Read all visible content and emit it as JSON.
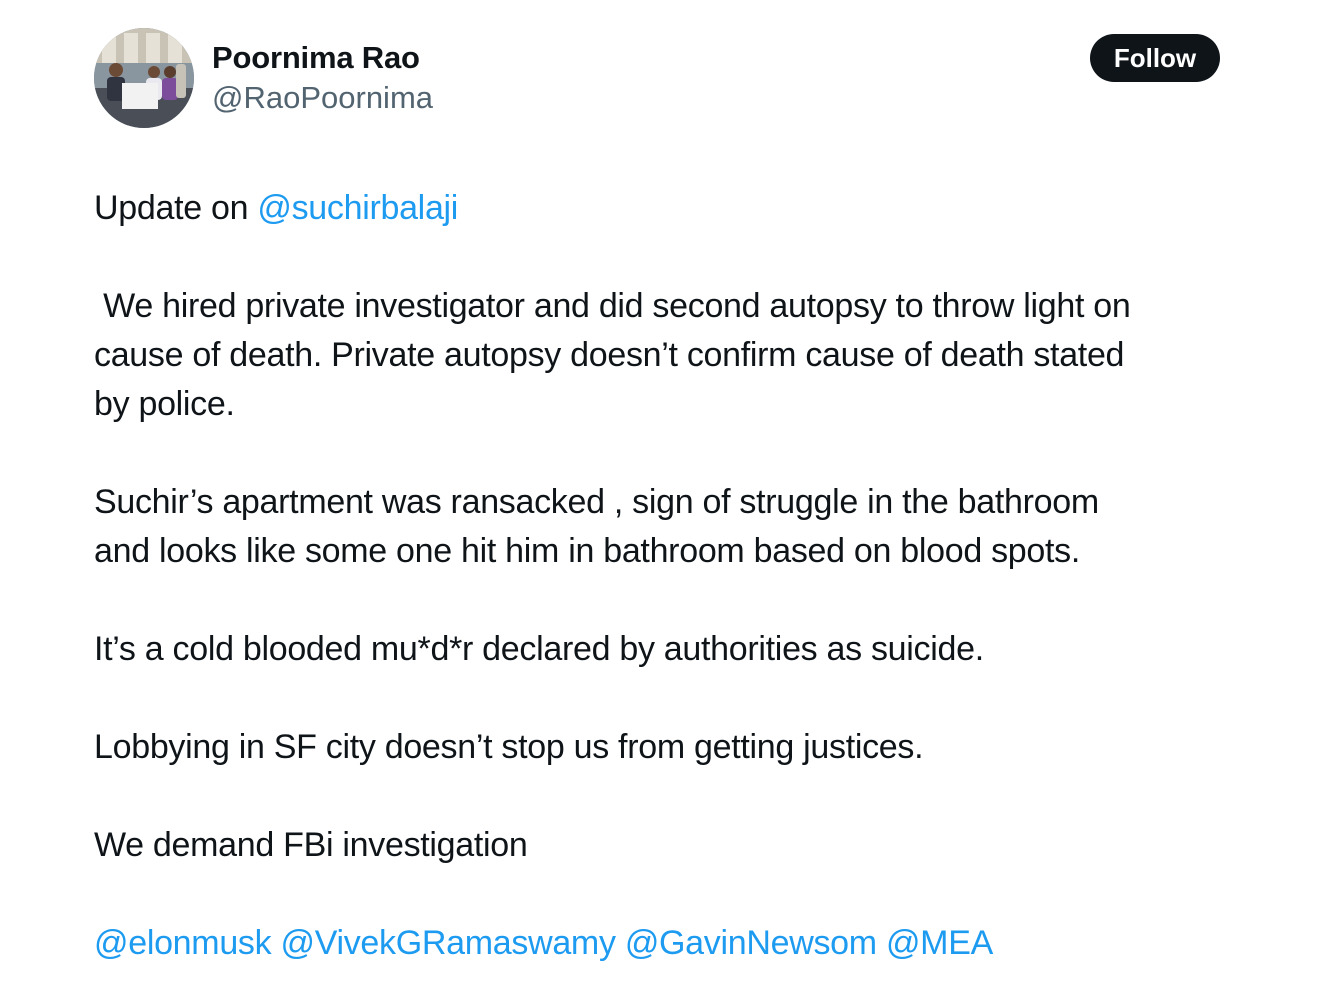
{
  "author": {
    "display_name": "Poornima Rao",
    "handle": "@RaoPoornima"
  },
  "follow_label": "Follow",
  "tweet": {
    "p1_prefix": "Update on ",
    "p1_mention": "@suchirbalaji",
    "p2_line1": " We hired private investigator and did second autopsy to throw light on",
    "p2_line2": "cause of death. Private autopsy doesn’t confirm cause of death stated",
    "p2_line3": "by police.",
    "p3_line1": "Suchir’s apartment was ransacked , sign of struggle in the bathroom",
    "p3_line2": "and looks like some one hit him in bathroom based on blood spots.",
    "p4": "It’s a cold blooded mu*d*r declared by authorities as suicide.",
    "p5": "Lobbying in SF city doesn’t stop us from getting justices.",
    "p6": "We demand FBi investigation",
    "mentions": [
      "@elonmusk",
      "@VivekGRamaswamy",
      "@GavinNewsom",
      "@MEA"
    ]
  },
  "colors": {
    "link": "#1d9bf0",
    "text": "#0f1419",
    "secondary": "#536471",
    "button_bg": "#0f1419"
  }
}
